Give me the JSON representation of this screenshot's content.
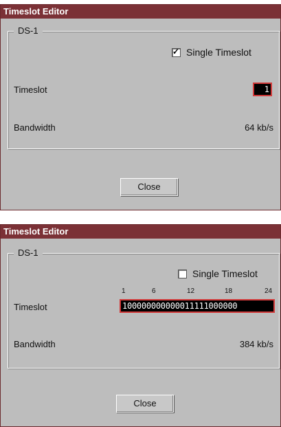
{
  "dialog1": {
    "title": "Timeslot Editor",
    "group_label": "DS-1",
    "single_timeslot_label": "Single Timeslot",
    "single_timeslot_checked": true,
    "timeslot_label": "Timeslot",
    "timeslot_value": "1",
    "bandwidth_label": "Bandwidth",
    "bandwidth_value": "64 kb/s",
    "close_label": "Close"
  },
  "dialog2": {
    "title": "Timeslot Editor",
    "group_label": "DS-1",
    "single_timeslot_label": "Single Timeslot",
    "single_timeslot_checked": false,
    "ticks": [
      "1",
      "6",
      "12",
      "18",
      "24"
    ],
    "timeslot_label": "Timeslot",
    "timeslot_value": "100000000000011111000000",
    "bandwidth_label": "Bandwidth",
    "bandwidth_value": "384 kb/s",
    "close_label": "Close"
  },
  "colors": {
    "titlebar": "#7b3136",
    "dialog_bg": "#bdbdbd",
    "field_border": "#d23a3a"
  }
}
